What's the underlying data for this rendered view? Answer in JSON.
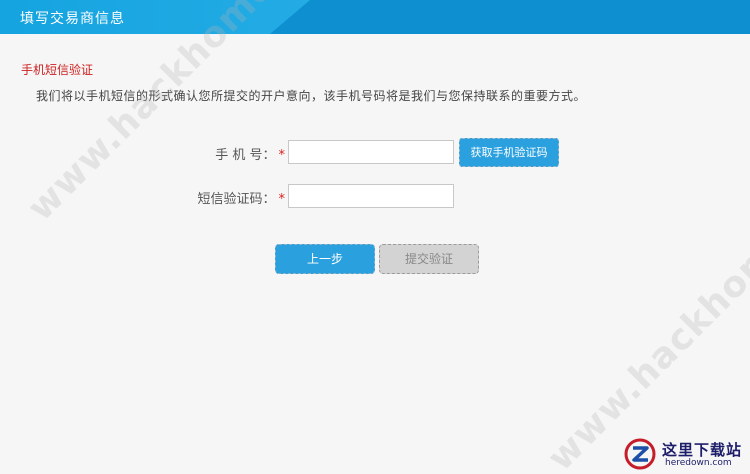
{
  "header": {
    "title": "填写交易商信息"
  },
  "verification": {
    "section_title": "手机短信验证",
    "description": "我们将以手机短信的形式确认您所提交的开户意向，该手机号码将是我们与您保持联系的重要方式。",
    "phone_label": "手 机 号：",
    "code_label": "短信验证码：",
    "required_mark": "*",
    "phone_value": "",
    "code_value": "",
    "get_code_button": "获取手机验证码"
  },
  "actions": {
    "prev_button": "上一步",
    "submit_button": "提交验证"
  },
  "watermark": {
    "text": "www.hackhome.com"
  },
  "logo": {
    "cn": "这里下载站",
    "en": "heredown.com"
  },
  "colors": {
    "header": "#1e9bd8",
    "primary_button": "#2ba0df",
    "disabled_button": "#d3d3d3",
    "section_title": "#cc1f1f",
    "required": "#d81e1e"
  }
}
